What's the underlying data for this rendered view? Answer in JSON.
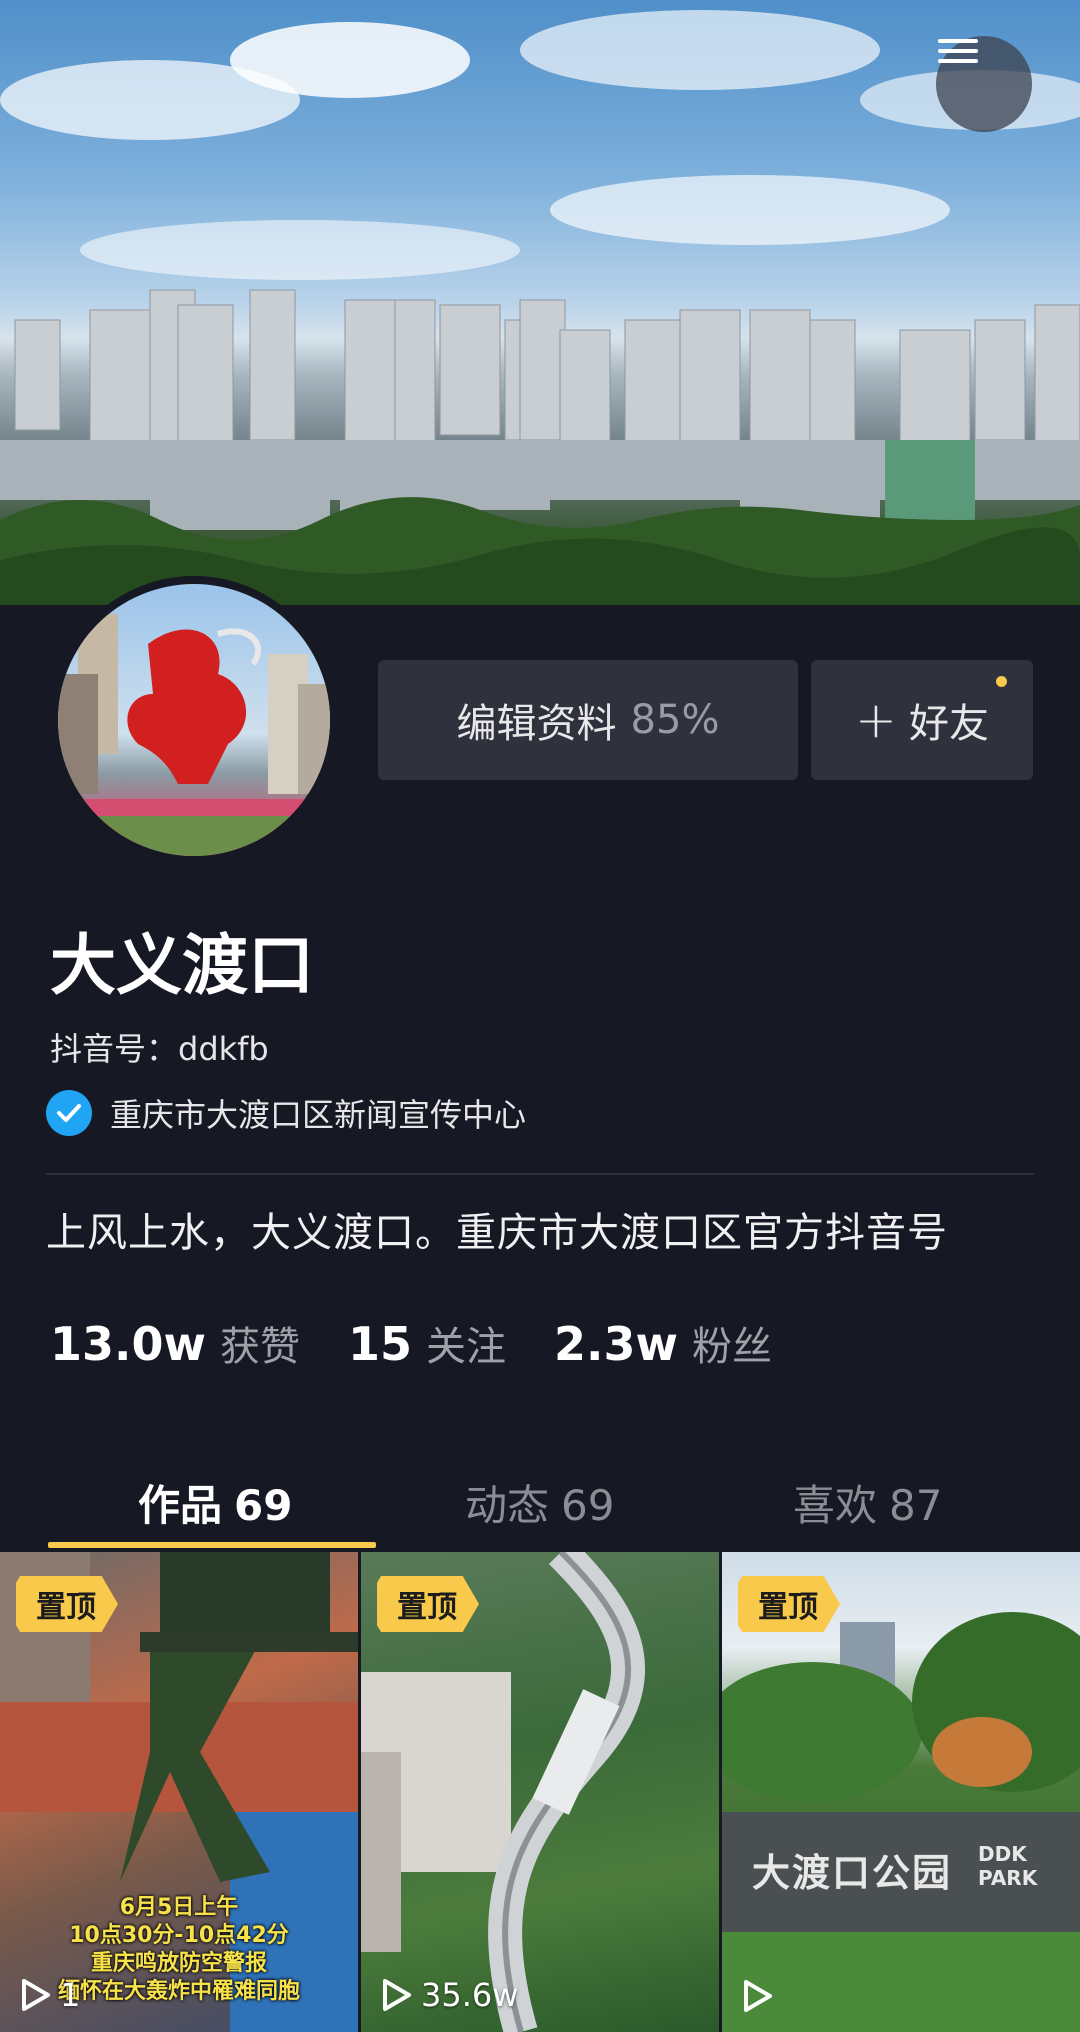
{
  "header": {
    "menu_icon": "hamburger-icon"
  },
  "profile": {
    "edit_label": "编辑资料",
    "edit_percent": "85%",
    "add_friend_label": "好友",
    "name": "大义渡口",
    "douyin_id": "抖音号：ddkfb",
    "verified_text": "重庆市大渡口区新闻宣传中心",
    "bio": "上风上水，大义渡口。重庆市大渡口区官方抖音号"
  },
  "stats": [
    {
      "num": "13.0w",
      "label": "获赞"
    },
    {
      "num": "15",
      "label": "关注"
    },
    {
      "num": "2.3w",
      "label": "粉丝"
    }
  ],
  "tabs": [
    {
      "label": "作品",
      "count": "69"
    },
    {
      "label": "动态",
      "count": "69"
    },
    {
      "label": "喜欢",
      "count": "87"
    }
  ],
  "videos": [
    {
      "pin": "置顶",
      "plays": "1",
      "overlay": [
        "6月5日上午",
        "10点30分-10点42分",
        "重庆鸣放防空警报",
        "缅怀在大轰炸中罹难同胞"
      ]
    },
    {
      "pin": "置顶",
      "plays": "35.6w"
    },
    {
      "pin": "置顶",
      "plays": "",
      "sign_text": "大渡口公园",
      "sign_sub": "DDK PARK"
    }
  ],
  "colors": {
    "background": "#161823",
    "accent": "#f8c94a",
    "verified": "#20a5f5"
  }
}
